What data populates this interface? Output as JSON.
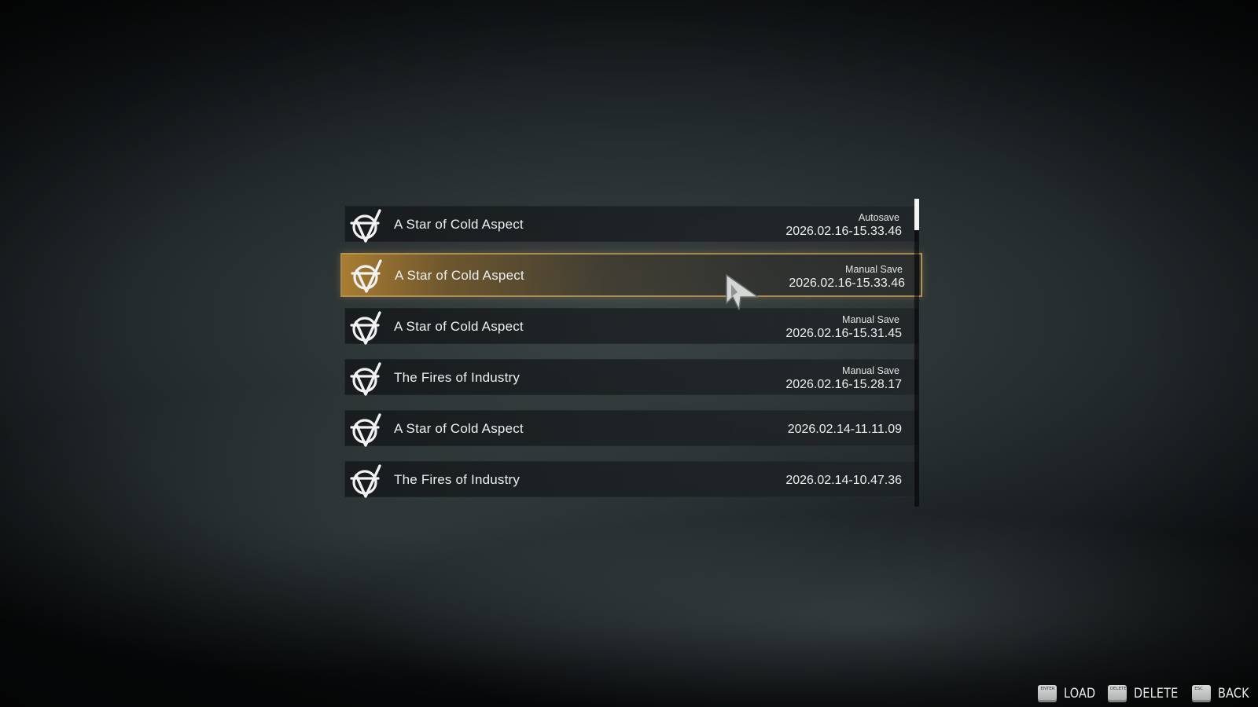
{
  "saves": [
    {
      "title": "A Star of Cold Aspect",
      "type": "Autosave",
      "timestamp": "2026.02.16-15.33.46",
      "selected": false
    },
    {
      "title": "A Star of Cold Aspect",
      "type": "Manual Save",
      "timestamp": "2026.02.16-15.33.46",
      "selected": true
    },
    {
      "title": "A Star of Cold Aspect",
      "type": "Manual Save",
      "timestamp": "2026.02.16-15.31.45",
      "selected": false
    },
    {
      "title": "The Fires of Industry",
      "type": "Manual Save",
      "timestamp": "2026.02.16-15.28.17",
      "selected": false
    },
    {
      "title": "A Star of Cold Aspect",
      "type": "",
      "timestamp": "2026.02.14-11.11.09",
      "selected": false
    },
    {
      "title": "The Fires of Industry",
      "type": "",
      "timestamp": "2026.02.14-10.47.36",
      "selected": false
    }
  ],
  "row_icon": "anarchy-circle-emblem-icon",
  "cursor_icon": "arrow-cursor-icon",
  "key_hints": [
    {
      "key": "ENTER",
      "label": "LOAD"
    },
    {
      "key": "DELETE",
      "label": "DELETE"
    },
    {
      "key": "ESC",
      "label": "BACK"
    }
  ],
  "colors": {
    "selected_border": "#ba9654",
    "selected_fill": "#b08030",
    "row_fill": "#181d1f",
    "text": "#eef0ef"
  }
}
